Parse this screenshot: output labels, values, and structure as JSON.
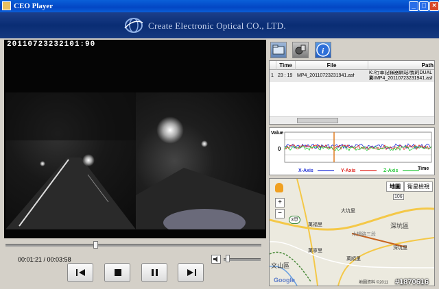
{
  "window": {
    "title": "CEO Player"
  },
  "header": {
    "company_name": "Create Electronic Optical CO., LTD."
  },
  "video": {
    "timestamp": "20110723232101:90"
  },
  "player": {
    "time_readout": "00:01:21 / 00:03:58",
    "seek_progress": 0.35,
    "volume_level": 0.05
  },
  "file_table": {
    "columns": [
      "Time",
      "File",
      "Path"
    ],
    "rows": [
      {
        "index": "1",
        "time": "23 : 19",
        "file": "MP4_20110723231941.asf",
        "path_line1": "K:/行車記錄器網站/我的DUAL影",
        "path_line2": "片/MP4_20110723231941.asf"
      }
    ]
  },
  "graph": {
    "y_label": "Value",
    "zero_label": "0",
    "time_label": "Time",
    "legend": [
      {
        "name": "X-Axis",
        "color": "#1f2fd6"
      },
      {
        "name": "Y-Axis",
        "color": "#e0201a"
      },
      {
        "name": "Z-Axis",
        "color": "#27c83a"
      }
    ],
    "cursor_color": "#e07a1f"
  },
  "map": {
    "tab_map": "地圖",
    "tab_satellite": "衛星檢視",
    "labels": {
      "district": "深坑區",
      "district2": "文山區",
      "road_106": "106",
      "road_3a": "3甲",
      "place_1": "大坑里",
      "place_2": "萬福里",
      "place_3": "萬寧里",
      "place_4": "萬順里",
      "place_5": "木柵路三段",
      "place_6": "深坑里",
      "copyright": "地圖資料 ©2011"
    },
    "google_logo": "Google"
  },
  "watermark": "#1870616"
}
